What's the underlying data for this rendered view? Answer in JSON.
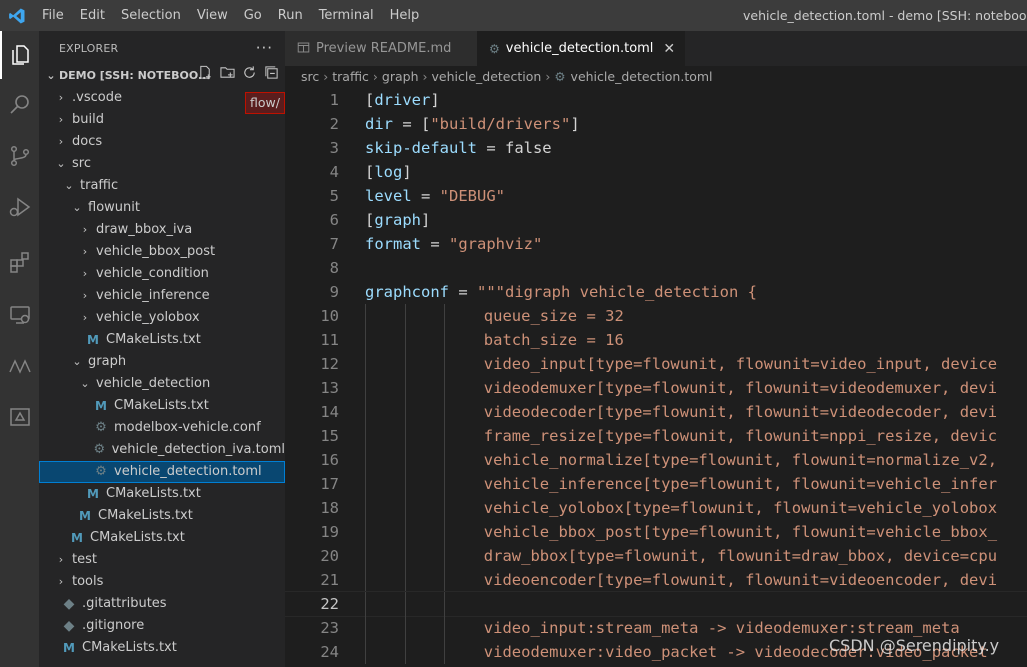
{
  "titlebar": {
    "menu": [
      "File",
      "Edit",
      "Selection",
      "View",
      "Go",
      "Run",
      "Terminal",
      "Help"
    ],
    "window_title": "vehicle_detection.toml - demo [SSH: notebook-no-del"
  },
  "activity_bar": {
    "icons": [
      "explorer-icon",
      "search-icon",
      "source-control-icon",
      "run-debug-icon",
      "extensions-icon",
      "remote-explorer-icon",
      "modelbox-icon",
      "panel-icon"
    ]
  },
  "sidebar": {
    "title": "EXPLORER",
    "more": "···",
    "section": "DEMO [SSH: NOTEBOO...",
    "tooltip": "flow/",
    "tree": [
      {
        "label": ".vscode",
        "kind": "folder",
        "open": false,
        "depth": 1
      },
      {
        "label": "build",
        "kind": "folder",
        "open": false,
        "depth": 1
      },
      {
        "label": "docs",
        "kind": "folder",
        "open": false,
        "depth": 1
      },
      {
        "label": "src",
        "kind": "folder",
        "open": true,
        "depth": 1
      },
      {
        "label": "traffic",
        "kind": "folder",
        "open": true,
        "depth": 2
      },
      {
        "label": "flowunit",
        "kind": "folder",
        "open": true,
        "depth": 3
      },
      {
        "label": "draw_bbox_iva",
        "kind": "folder",
        "open": false,
        "depth": 4
      },
      {
        "label": "vehicle_bbox_post",
        "kind": "folder",
        "open": false,
        "depth": 4
      },
      {
        "label": "vehicle_condition",
        "kind": "folder",
        "open": false,
        "depth": 4
      },
      {
        "label": "vehicle_inference",
        "kind": "folder",
        "open": false,
        "depth": 4
      },
      {
        "label": "vehicle_yolobox",
        "kind": "folder",
        "open": false,
        "depth": 4
      },
      {
        "label": "CMakeLists.txt",
        "kind": "cmake",
        "depth": 4
      },
      {
        "label": "graph",
        "kind": "folder",
        "open": true,
        "depth": 3
      },
      {
        "label": "vehicle_detection",
        "kind": "folder",
        "open": true,
        "depth": 4
      },
      {
        "label": "CMakeLists.txt",
        "kind": "cmake",
        "depth": 5
      },
      {
        "label": "modelbox-vehicle.conf",
        "kind": "gear",
        "depth": 5
      },
      {
        "label": "vehicle_detection_iva.toml",
        "kind": "gear",
        "depth": 5
      },
      {
        "label": "vehicle_detection.toml",
        "kind": "gear",
        "depth": 5,
        "selected": true
      },
      {
        "label": "CMakeLists.txt",
        "kind": "cmake",
        "depth": 4
      },
      {
        "label": "CMakeLists.txt",
        "kind": "cmake",
        "depth": 3
      },
      {
        "label": "CMakeLists.txt",
        "kind": "cmake",
        "depth": 2
      },
      {
        "label": "test",
        "kind": "folder",
        "open": false,
        "depth": 1
      },
      {
        "label": "tools",
        "kind": "folder",
        "open": false,
        "depth": 1
      },
      {
        "label": ".gitattributes",
        "kind": "dot",
        "depth": 1
      },
      {
        "label": ".gitignore",
        "kind": "dot",
        "depth": 1
      },
      {
        "label": "CMakeLists.txt",
        "kind": "cmake",
        "depth": 1
      }
    ]
  },
  "tabs": [
    {
      "label": "Preview README.md",
      "active": false
    },
    {
      "label": "vehicle_detection.toml",
      "active": true
    }
  ],
  "breadcrumb": [
    "src",
    "traffic",
    "graph",
    "vehicle_detection",
    "vehicle_detection.toml"
  ],
  "editor": {
    "current_line": 22,
    "lines": [
      {
        "n": "1",
        "indent": 0,
        "tokens": [
          [
            "p",
            "["
          ],
          [
            "k",
            "driver"
          ],
          [
            "p",
            "]"
          ]
        ]
      },
      {
        "n": "2",
        "indent": 0,
        "tokens": [
          [
            "k",
            "dir"
          ],
          [
            "p",
            " = ["
          ],
          [
            "s",
            "\"build/drivers\""
          ],
          [
            "p",
            "]"
          ]
        ]
      },
      {
        "n": "3",
        "indent": 0,
        "tokens": [
          [
            "k",
            "skip-default"
          ],
          [
            "p",
            " = "
          ],
          [
            "b",
            "false"
          ]
        ]
      },
      {
        "n": "4",
        "indent": 0,
        "tokens": [
          [
            "p",
            "["
          ],
          [
            "k",
            "log"
          ],
          [
            "p",
            "]"
          ]
        ]
      },
      {
        "n": "5",
        "indent": 0,
        "tokens": [
          [
            "k",
            "level"
          ],
          [
            "p",
            " = "
          ],
          [
            "s",
            "\"DEBUG\""
          ]
        ]
      },
      {
        "n": "6",
        "indent": 0,
        "tokens": [
          [
            "p",
            "["
          ],
          [
            "k",
            "graph"
          ],
          [
            "p",
            "]"
          ]
        ]
      },
      {
        "n": "7",
        "indent": 0,
        "tokens": [
          [
            "k",
            "format"
          ],
          [
            "p",
            " = "
          ],
          [
            "s",
            "\"graphviz\""
          ]
        ]
      },
      {
        "n": "8",
        "indent": 0,
        "tokens": []
      },
      {
        "n": "9",
        "indent": 0,
        "tokens": [
          [
            "k",
            "graphconf"
          ],
          [
            "p",
            " = "
          ],
          [
            "s",
            "\"\"\"digraph vehicle_detection {"
          ]
        ]
      },
      {
        "n": "10",
        "indent": 3,
        "tokens": [
          [
            "s",
            "queue_size = 32"
          ]
        ]
      },
      {
        "n": "11",
        "indent": 3,
        "tokens": [
          [
            "s",
            "batch_size = 16"
          ]
        ]
      },
      {
        "n": "12",
        "indent": 3,
        "tokens": [
          [
            "s",
            "video_input[type=flowunit, flowunit=video_input, device"
          ]
        ]
      },
      {
        "n": "13",
        "indent": 3,
        "tokens": [
          [
            "s",
            "videodemuxer[type=flowunit, flowunit=videodemuxer, devi"
          ]
        ]
      },
      {
        "n": "14",
        "indent": 3,
        "tokens": [
          [
            "s",
            "videodecoder[type=flowunit, flowunit=videodecoder, devi"
          ]
        ]
      },
      {
        "n": "15",
        "indent": 3,
        "tokens": [
          [
            "s",
            "frame_resize[type=flowunit, flowunit=nppi_resize, devic"
          ]
        ]
      },
      {
        "n": "16",
        "indent": 3,
        "tokens": [
          [
            "s",
            "vehicle_normalize[type=flowunit, flowunit=normalize_v2,"
          ]
        ]
      },
      {
        "n": "17",
        "indent": 3,
        "tokens": [
          [
            "s",
            "vehicle_inference[type=flowunit, flowunit=vehicle_infer"
          ]
        ]
      },
      {
        "n": "18",
        "indent": 3,
        "tokens": [
          [
            "s",
            "vehicle_yolobox[type=flowunit, flowunit=vehicle_yolobox"
          ]
        ]
      },
      {
        "n": "19",
        "indent": 3,
        "tokens": [
          [
            "s",
            "vehicle_bbox_post[type=flowunit, flowunit=vehicle_bbox_"
          ]
        ]
      },
      {
        "n": "20",
        "indent": 3,
        "tokens": [
          [
            "s",
            "draw_bbox[type=flowunit, flowunit=draw_bbox, device=cpu"
          ]
        ]
      },
      {
        "n": "21",
        "indent": 3,
        "tokens": [
          [
            "s",
            "videoencoder[type=flowunit, flowunit=videoencoder, devi"
          ]
        ]
      },
      {
        "n": "22",
        "indent": 3,
        "tokens": []
      },
      {
        "n": "23",
        "indent": 3,
        "tokens": [
          [
            "s",
            "video_input:stream_meta -> videodemuxer:stream_meta"
          ]
        ]
      },
      {
        "n": "24",
        "indent": 3,
        "tokens": [
          [
            "s",
            "videodemuxer:video_packet -> videodecoder:video_packet"
          ]
        ]
      }
    ]
  },
  "watermark": "CSDN @Serendipity.y",
  "colors": {
    "accent": "#007acc",
    "key": "#9cdcfe",
    "string": "#ce9178",
    "selection": "#094771"
  }
}
